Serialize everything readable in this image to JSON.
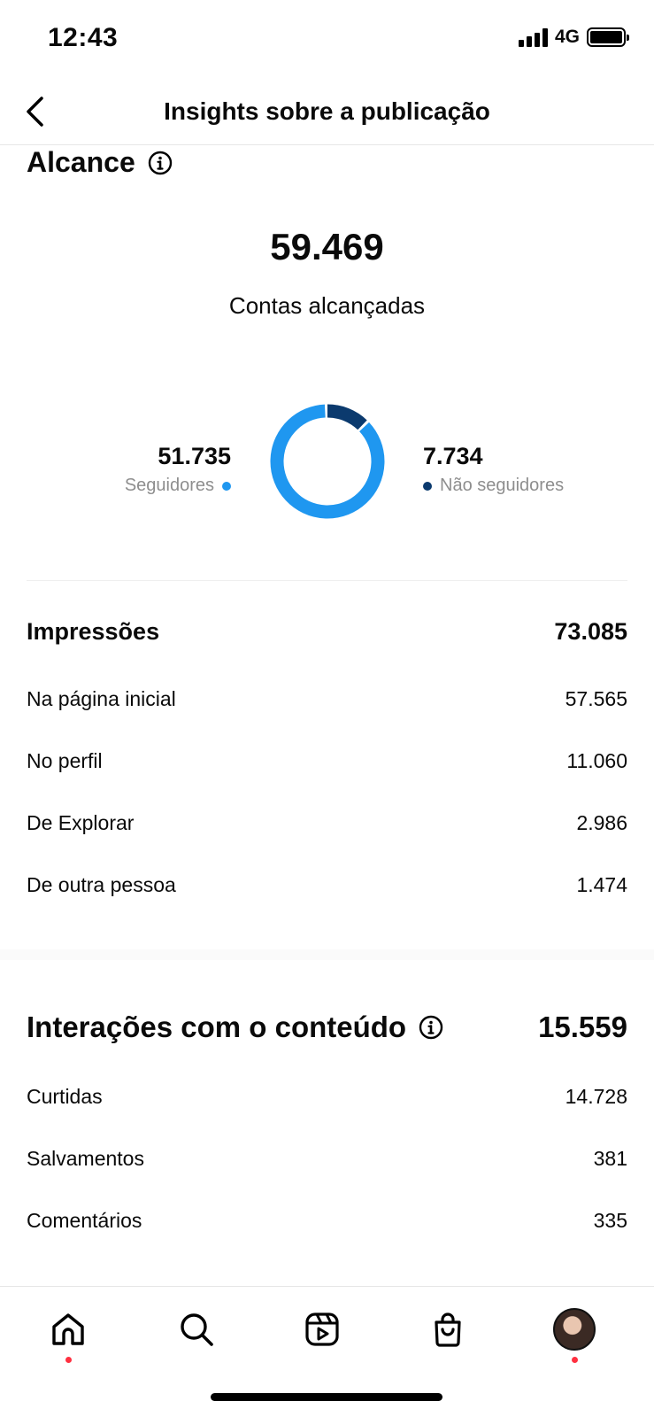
{
  "status_bar": {
    "time": "12:43",
    "network": "4G"
  },
  "header": {
    "title": "Insights sobre a publicação"
  },
  "reach": {
    "title": "Alcance",
    "value": "59.469",
    "label": "Contas alcançadas",
    "followers": {
      "value": "51.735",
      "label": "Seguidores",
      "count": 51735,
      "color": "#1f97f0"
    },
    "non_followers": {
      "value": "7.734",
      "label": "Não seguidores",
      "count": 7734,
      "color": "#0b3a6e"
    }
  },
  "impressions": {
    "title": "Impressões",
    "total": "73.085",
    "rows": [
      {
        "label": "Na página inicial",
        "value": "57.565"
      },
      {
        "label": "No perfil",
        "value": "11.060"
      },
      {
        "label": "De Explorar",
        "value": "2.986"
      },
      {
        "label": "De outra pessoa",
        "value": "1.474"
      }
    ]
  },
  "interactions": {
    "title": "Interações com o conteúdo",
    "total": "15.559",
    "rows": [
      {
        "label": "Curtidas",
        "value": "14.728"
      },
      {
        "label": "Salvamentos",
        "value": "381"
      },
      {
        "label": "Comentários",
        "value": "335"
      }
    ]
  },
  "tabbar": {
    "items": [
      {
        "icon": "home-icon",
        "badge": true
      },
      {
        "icon": "search-icon",
        "badge": false
      },
      {
        "icon": "reels-icon",
        "badge": false
      },
      {
        "icon": "shop-icon",
        "badge": false
      },
      {
        "icon": "profile-avatar",
        "badge": true
      }
    ],
    "badge_color": "#ff3040"
  }
}
